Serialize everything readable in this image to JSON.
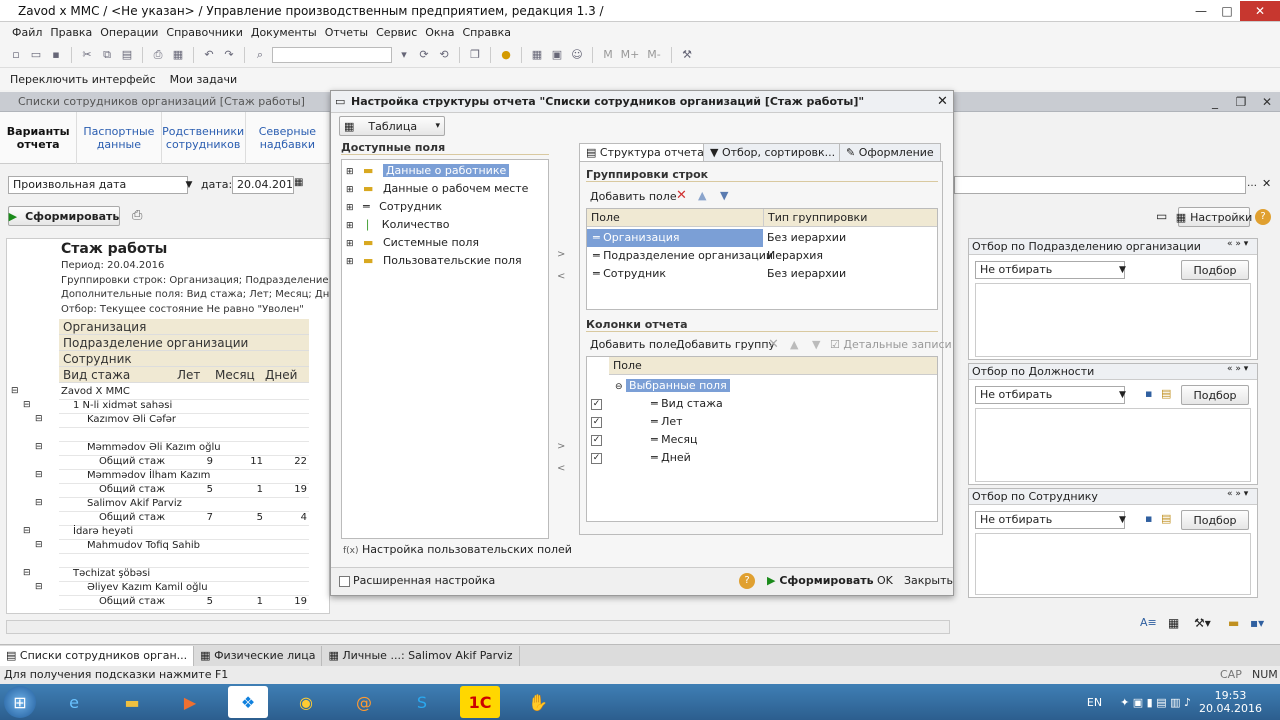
{
  "window": {
    "title": "Zavod x MMC / <Не указан> / Управление производственным предприятием, редакция 1.3 /"
  },
  "menu": [
    "Файл",
    "Правка",
    "Операции",
    "Справочники",
    "Документы",
    "Отчеты",
    "Сервис",
    "Окна",
    "Справка"
  ],
  "interface_bar": {
    "switch": "Переключить интерфейс",
    "tasks": "Мои задачи"
  },
  "child_window": {
    "title": "Списки сотрудников организаций [Стаж работы]"
  },
  "left_tabs": [
    "Варианты отчета",
    "Паспортные данные",
    "Родственники сотрудников",
    "Северные надбавки"
  ],
  "date_row": {
    "mode": "Произвольная дата",
    "label": "дата:",
    "value": "20.04.2016"
  },
  "generate_label": "Сформировать",
  "report": {
    "title": "Стаж работы",
    "lines": [
      "Период: 20.04.2016",
      "Группировки строк: Организация; Подразделение организ",
      "Дополнительные поля: Вид стажа; Лет; Месяц; Дней;",
      "Отбор: Текущее состояние Не равно \"Уволен\""
    ],
    "headers": [
      "Организация",
      "Подразделение организации",
      "Сотрудник",
      "Вид стажа"
    ],
    "cols": [
      "Лет",
      "Месяц",
      "Дней"
    ],
    "rows": [
      {
        "text": "Zavod  X MMC",
        "l": "",
        "m": "",
        "d": ""
      },
      {
        "text": "1 N-li xidmət sahəsi",
        "l": "",
        "m": "",
        "d": ""
      },
      {
        "text": "Kazımov Əli Cəfər",
        "l": "",
        "m": "",
        "d": ""
      },
      {
        "text": "",
        "l": "",
        "m": "",
        "d": ""
      },
      {
        "text": "Məmmədov Əli Kazım oğlu",
        "l": "",
        "m": "",
        "d": ""
      },
      {
        "text": "Общий стаж",
        "l": "9",
        "m": "11",
        "d": "22"
      },
      {
        "text": "Məmmədov İlham Kazım",
        "l": "",
        "m": "",
        "d": ""
      },
      {
        "text": "Общий стаж",
        "l": "5",
        "m": "1",
        "d": "19"
      },
      {
        "text": "Salimov Akif Parviz",
        "l": "",
        "m": "",
        "d": ""
      },
      {
        "text": "Общий стаж",
        "l": "7",
        "m": "5",
        "d": "4"
      },
      {
        "text": "İdarə heyəti",
        "l": "",
        "m": "",
        "d": ""
      },
      {
        "text": "Mahmudov Tofiq Sahib",
        "l": "",
        "m": "",
        "d": ""
      },
      {
        "text": "",
        "l": "",
        "m": "",
        "d": ""
      },
      {
        "text": "Təchizat şöbəsi",
        "l": "",
        "m": "",
        "d": ""
      },
      {
        "text": "Əliyev Kazım Kamil oğlu",
        "l": "",
        "m": "",
        "d": ""
      },
      {
        "text": "Общий стаж",
        "l": "5",
        "m": "1",
        "d": "19"
      }
    ]
  },
  "dialog": {
    "title": "Настройка структуры отчета \"Списки сотрудников организаций [Стаж работы]\"",
    "view_mode": "Таблица",
    "available_fields_title": "Доступные поля",
    "tree": [
      "Данные о работнике",
      "Данные о рабочем месте",
      "Сотрудник",
      "Количество",
      "Системные поля",
      "Пользовательские поля"
    ],
    "custom_fields": "Настройка пользовательских полей",
    "tabs": [
      "Структура отчета",
      "Отбор, сортировк...",
      "Оформление"
    ],
    "row_groups_title": "Группировки строк",
    "add_field": "Добавить поле",
    "group_cols": [
      "Поле",
      "Тип группировки"
    ],
    "groups": [
      {
        "field": "Организация",
        "type": "Без иерархии"
      },
      {
        "field": "Подразделение организации",
        "type": "Иерархия"
      },
      {
        "field": "Сотрудник",
        "type": "Без иерархии"
      }
    ],
    "columns_title": "Колонки отчета",
    "add_group": "Добавить группу",
    "detail_records": "Детальные записи",
    "col_header": "Поле",
    "selected_fields": "Выбранные поля",
    "columns": [
      "Вид стажа",
      "Лет",
      "Месяц",
      "Дней"
    ],
    "extended": "Расширенная настройка",
    "generate": "Сформировать",
    "ok": "OK",
    "close": "Закрыть"
  },
  "settings_label": "Настройки",
  "filters": [
    {
      "title": "Отбор по Подразделению организации",
      "value": "Не отбирать",
      "pick": "Подбор"
    },
    {
      "title": "Отбор по Должности",
      "value": "Не отбирать",
      "pick": "Подбор"
    },
    {
      "title": "Отбор по Сотруднику",
      "value": "Не отбирать",
      "pick": "Подбор"
    }
  ],
  "window_tabs": [
    "Списки сотрудников орган...",
    "Физические лица",
    "Личные ...: Salimov Akif Parviz"
  ],
  "status": {
    "hint": "Для получения подсказки нажмите F1",
    "cap": "CAP",
    "num": "NUM"
  },
  "tray": {
    "lang": "EN",
    "time": "19:53",
    "date": "20.04.2016"
  }
}
